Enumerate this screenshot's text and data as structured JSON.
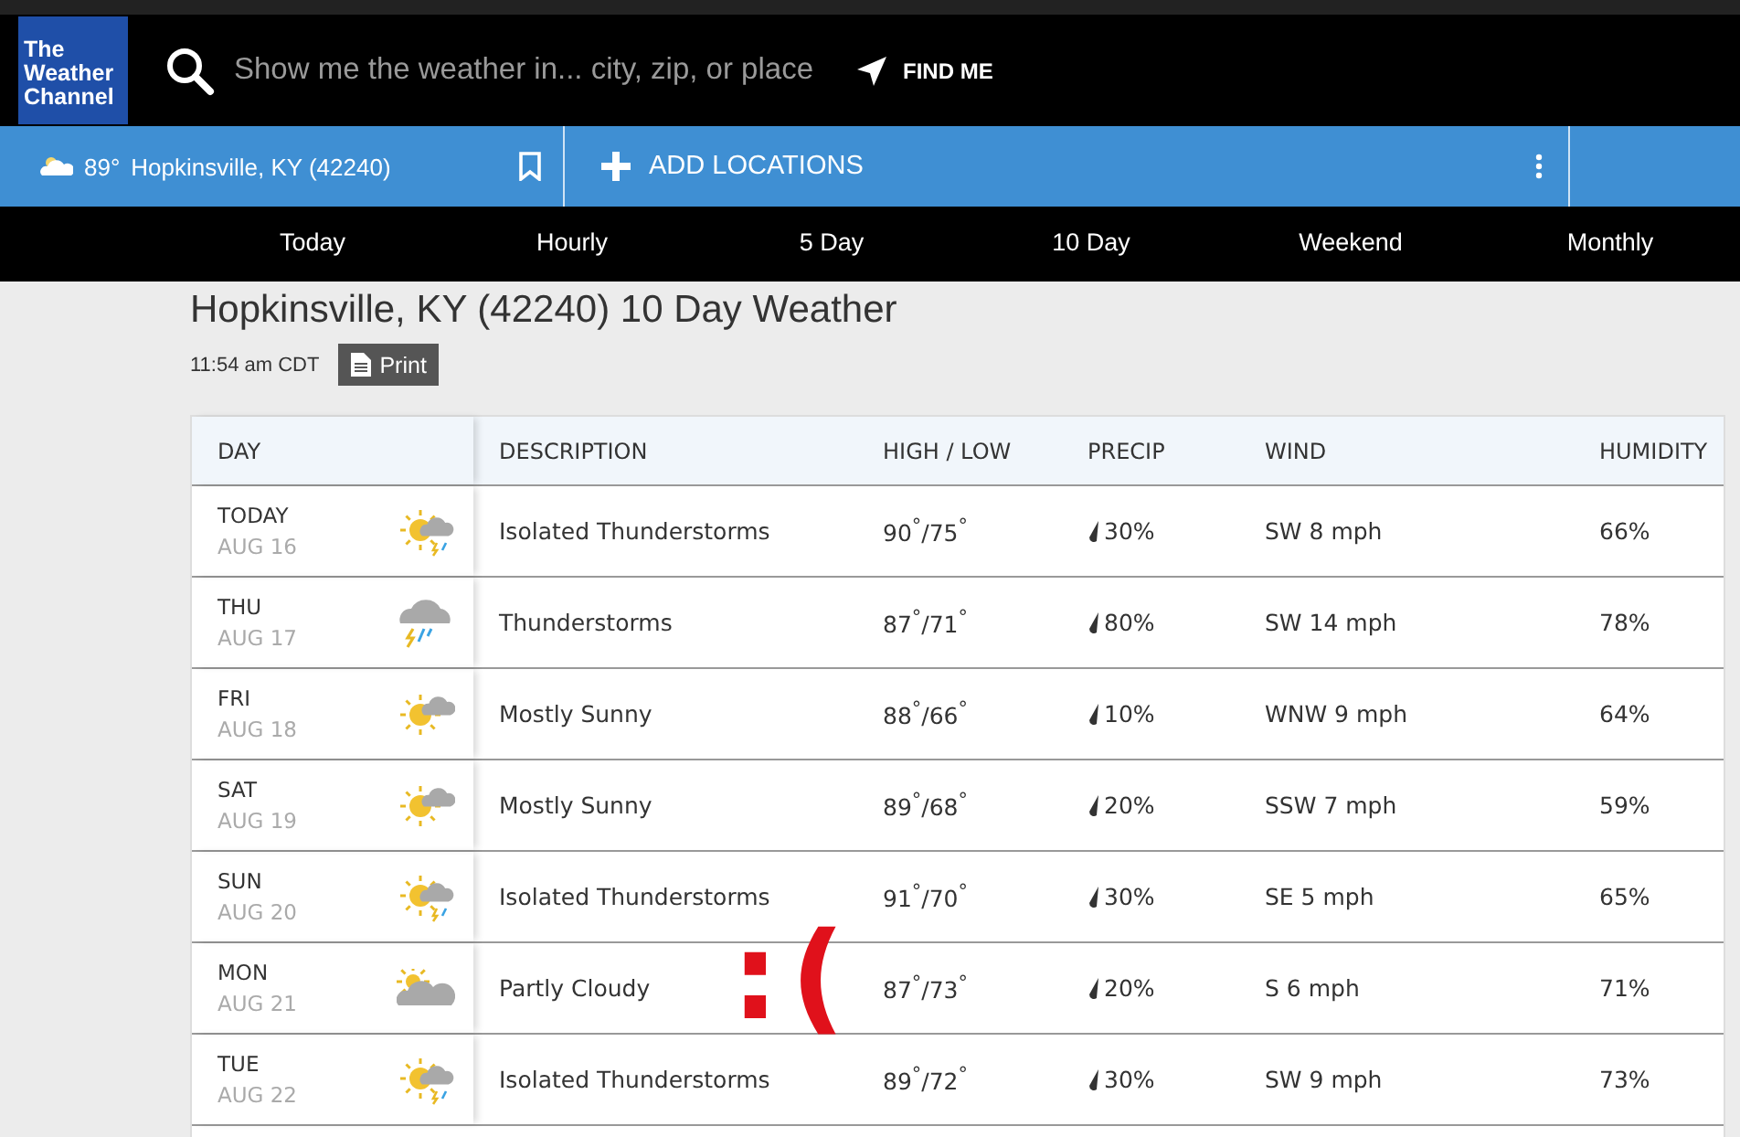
{
  "logo": {
    "lines": [
      "The",
      "Weather",
      "Channel"
    ]
  },
  "search": {
    "placeholder": "Show me the weather in... city, zip, or place"
  },
  "find_me": "FIND ME",
  "location_bar": {
    "temperature": "89°",
    "location": "Hopkinsville, KY (42240)",
    "add_label": "ADD LOCATIONS"
  },
  "nav": [
    {
      "label": "Today",
      "selected": false
    },
    {
      "label": "Hourly",
      "selected": false
    },
    {
      "label": "5 Day",
      "selected": false
    },
    {
      "label": "10 Day",
      "selected": false
    },
    {
      "label": "Weekend",
      "selected": false
    },
    {
      "label": "Monthly",
      "selected": false
    }
  ],
  "page_title": "Hopkinsville, KY (42240) 10 Day Weather",
  "timestamp": "11:54 am CDT",
  "print_button": "Print",
  "table": {
    "columns": [
      "DAY",
      "DESCRIPTION",
      "HIGH / LOW",
      "PRECIP",
      "WIND",
      "HUMIDITY"
    ],
    "rows": [
      {
        "day": "TODAY",
        "date": "AUG 16",
        "kind": "sun-storm",
        "description": "Isolated Thunderstorms",
        "high_low": "90$^{°}$/75$^{°}$",
        "precip": "30%",
        "wind": "SW 8 mph",
        "humidity": "66%"
      },
      {
        "day": "THU",
        "date": "AUG 17",
        "kind": "storm",
        "description": "Thunderstorms",
        "high_low": "87$^{°}$/71$^{°}$",
        "precip": "80%",
        "wind": "SW 14 mph",
        "humidity": "78%"
      },
      {
        "day": "FRI",
        "date": "AUG 18",
        "kind": "mostly-sunny",
        "description": "Mostly Sunny",
        "high_low": "88$^{°}$/66$^{°}$",
        "precip": "10%",
        "wind": "WNW 9 mph",
        "humidity": "64%"
      },
      {
        "day": "SAT",
        "date": "AUG 19",
        "kind": "mostly-sunny",
        "description": "Mostly Sunny",
        "high_low": "89$^{°}$/68$^{°}$",
        "precip": "20%",
        "wind": "SSW 7 mph",
        "humidity": "59%"
      },
      {
        "day": "SUN",
        "date": "AUG 20",
        "kind": "sun-storm",
        "description": "Isolated Thunderstorms",
        "high_low": "91$^{°}$/70$^{°}$",
        "precip": "30%",
        "wind": "SE 5 mph",
        "humidity": "65%"
      },
      {
        "day": "MON",
        "date": "AUG 21",
        "kind": "partly-cloudy",
        "description": "Partly Cloudy",
        "high_low": "87$^{°}$/73$^{°}$",
        "precip": "20%",
        "wind": "S 6 mph",
        "humidity": "71%"
      },
      {
        "day": "TUE",
        "date": "AUG 22",
        "kind": "sun-storm",
        "description": "Isolated Thunderstorms",
        "high_low": "89$^{°}$/72$^{°}$",
        "precip": "30%",
        "wind": "SW 9 mph",
        "humidity": "73%"
      }
    ]
  },
  "annotation": ":("
}
